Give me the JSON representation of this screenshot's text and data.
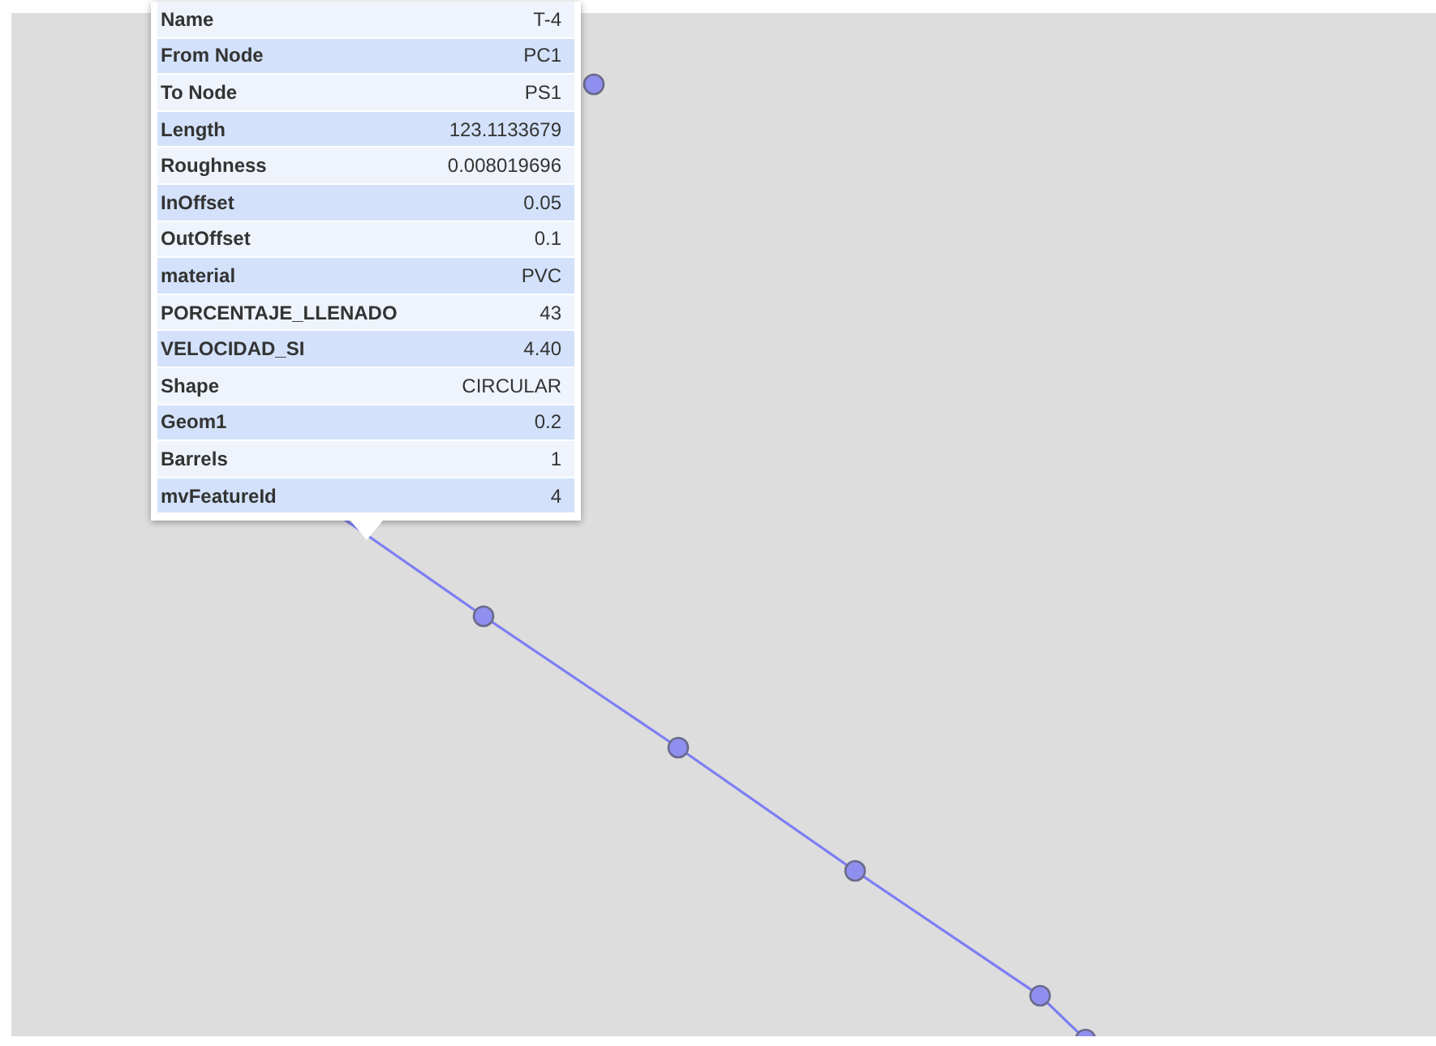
{
  "popup": {
    "rows": [
      {
        "label": "Name",
        "value": "T-4"
      },
      {
        "label": "From Node",
        "value": "PC1"
      },
      {
        "label": "To Node",
        "value": "PS1"
      },
      {
        "label": "Length",
        "value": "123.1133679"
      },
      {
        "label": "Roughness",
        "value": "0.008019696"
      },
      {
        "label": "InOffset",
        "value": "0.05"
      },
      {
        "label": "OutOffset",
        "value": "0.1"
      },
      {
        "label": "material",
        "value": "PVC"
      },
      {
        "label": "PORCENTAJE_LLENADO",
        "value": "43"
      },
      {
        "label": "VELOCIDAD_SI",
        "value": "4.40"
      },
      {
        "label": "Shape",
        "value": "CIRCULAR"
      },
      {
        "label": "Geom1",
        "value": "0.2"
      },
      {
        "label": "Barrels",
        "value": "1"
      },
      {
        "label": "mvFeatureId",
        "value": "4"
      }
    ]
  }
}
